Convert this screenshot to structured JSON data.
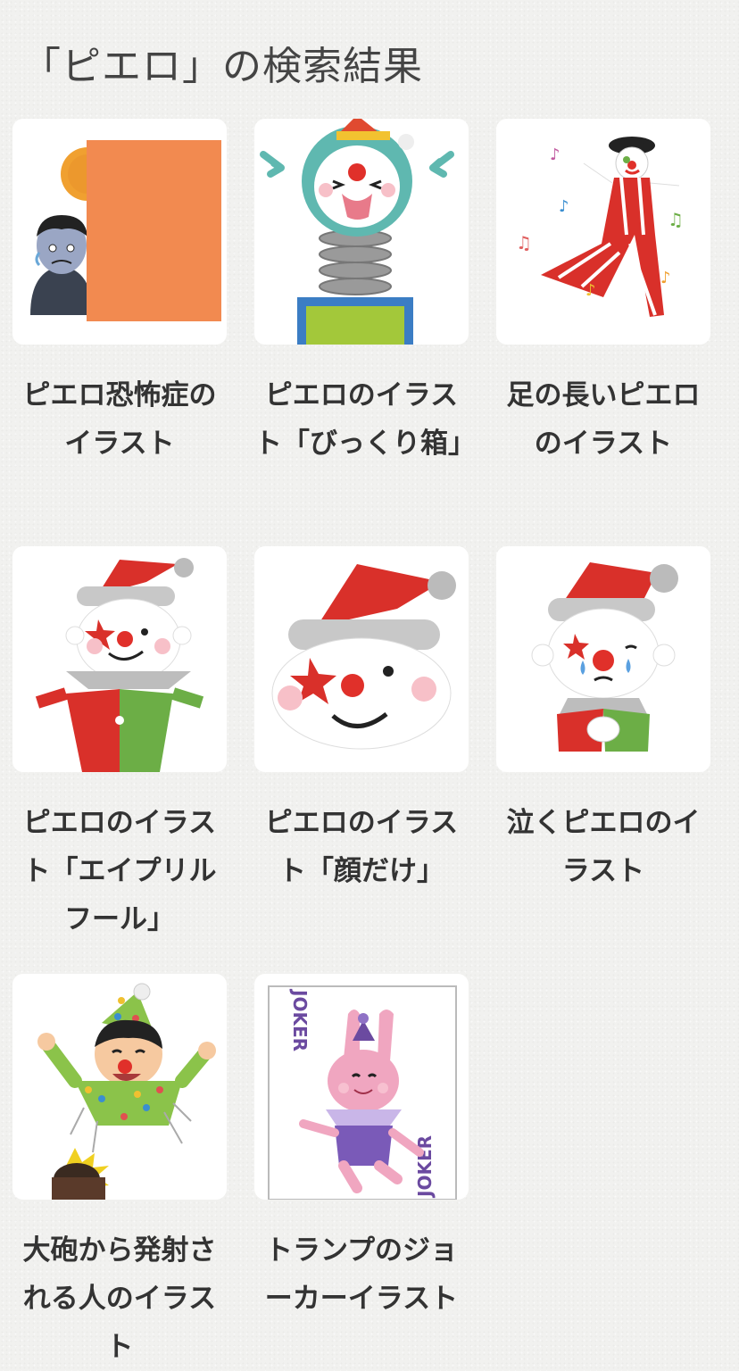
{
  "search": {
    "title": "「ピエロ」の検索結果"
  },
  "results": [
    {
      "caption": "ピエロ恐怖症のイラスト",
      "icon": "scared-man-clown-icon"
    },
    {
      "caption": "ピエロのイラスト「びっくり箱」",
      "icon": "jack-in-the-box-clown-icon"
    },
    {
      "caption": "足の長いピエロのイラスト",
      "icon": "stilt-clown-icon"
    },
    {
      "caption": "ピエロのイラスト「エイプリルフール」",
      "icon": "april-fool-clown-icon"
    },
    {
      "caption": "ピエロのイラスト「顔だけ」",
      "icon": "clown-face-icon"
    },
    {
      "caption": "泣くピエロのイラスト",
      "icon": "crying-clown-icon"
    },
    {
      "caption": "大砲から発射される人のイラスト",
      "icon": "human-cannonball-icon"
    },
    {
      "caption": "トランプのジョーカーイラスト",
      "icon": "joker-card-icon"
    }
  ],
  "joker_card": {
    "label": "JOKER",
    "label_rotated": "JOKER"
  },
  "colors": {
    "clown_red": "#d9302a",
    "clown_green": "#6cae46",
    "hat_gray": "#cfcfcf",
    "nose_red": "#e0302a",
    "orange_block": "#f28a50",
    "card_purple": "#6b4aa0"
  }
}
